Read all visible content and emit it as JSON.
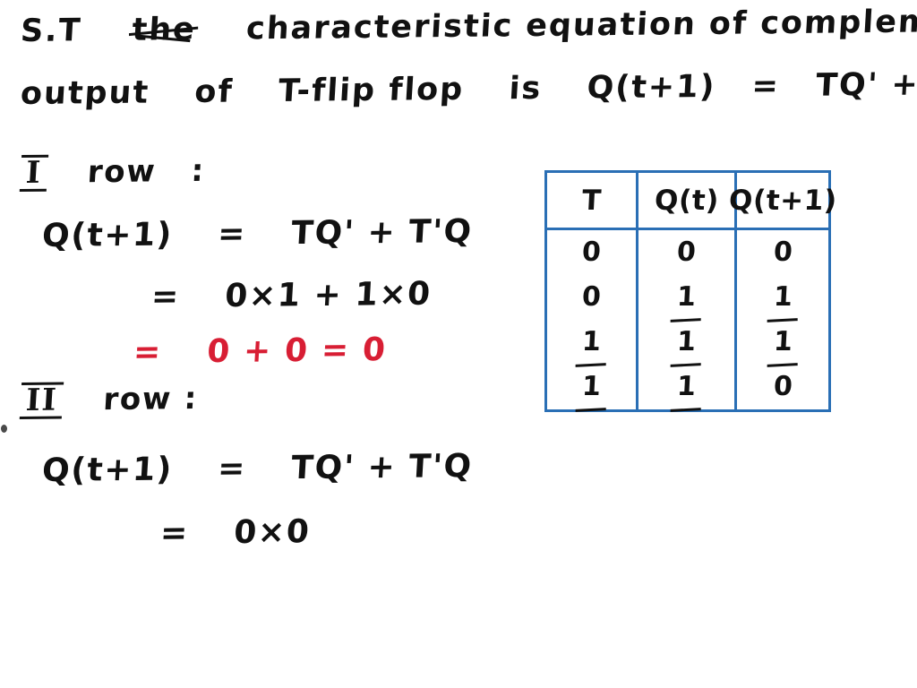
{
  "document": {
    "kind": "handwritten-worksheet",
    "ink_color": "#111111",
    "highlight_color": "#d81e34",
    "table_border_color": "#2a6fb5",
    "background_color": "#ffffff"
  },
  "problem": {
    "line1_part1": "S.T",
    "line1_struck_word": "the",
    "line1_part2": "characteristic equation of complementary",
    "line2_part1": "output",
    "line2_part2": "of",
    "line2_part3": "T-flip flop",
    "line2_part4": "is",
    "line2_equation_lhs": "Q(t+1)",
    "line2_equation_eq": "=",
    "line2_equation_rhs": "TQ' + T'Q"
  },
  "sections": [
    {
      "roman": "I",
      "label": "row",
      "colon": ":",
      "lines": [
        {
          "id": "i-row-eq1",
          "color": "black",
          "lhs": "Q(t+1)",
          "op": "=",
          "rhs": "TQ' + T'Q"
        },
        {
          "id": "i-row-eq2",
          "color": "black",
          "lhs": "",
          "op": "=",
          "rhs": "0×1 + 1×0"
        },
        {
          "id": "i-row-eq3",
          "color": "red",
          "lhs": "",
          "op": "=",
          "rhs": "0 + 0  = 0"
        }
      ]
    },
    {
      "roman": "II",
      "label": "row",
      "colon": ":",
      "lines": [
        {
          "id": "ii-row-eq1",
          "color": "black",
          "lhs": "Q(t+1)",
          "op": "=",
          "rhs": "TQ' + T'Q"
        },
        {
          "id": "ii-row-eq2",
          "color": "black",
          "lhs": "",
          "op": "=",
          "rhs": "0×0"
        }
      ]
    }
  ],
  "truth_table": {
    "headers": [
      "T",
      "Q(t)",
      "Q(t+1)"
    ],
    "rows": [
      [
        "0",
        "0",
        "0"
      ],
      [
        "0",
        "1",
        "1"
      ],
      [
        "1",
        "1",
        "1"
      ],
      [
        "1",
        "1",
        "0"
      ]
    ]
  },
  "glyphs": {
    "prime": "'",
    "times": "×",
    "plus": "+",
    "equals": "="
  }
}
